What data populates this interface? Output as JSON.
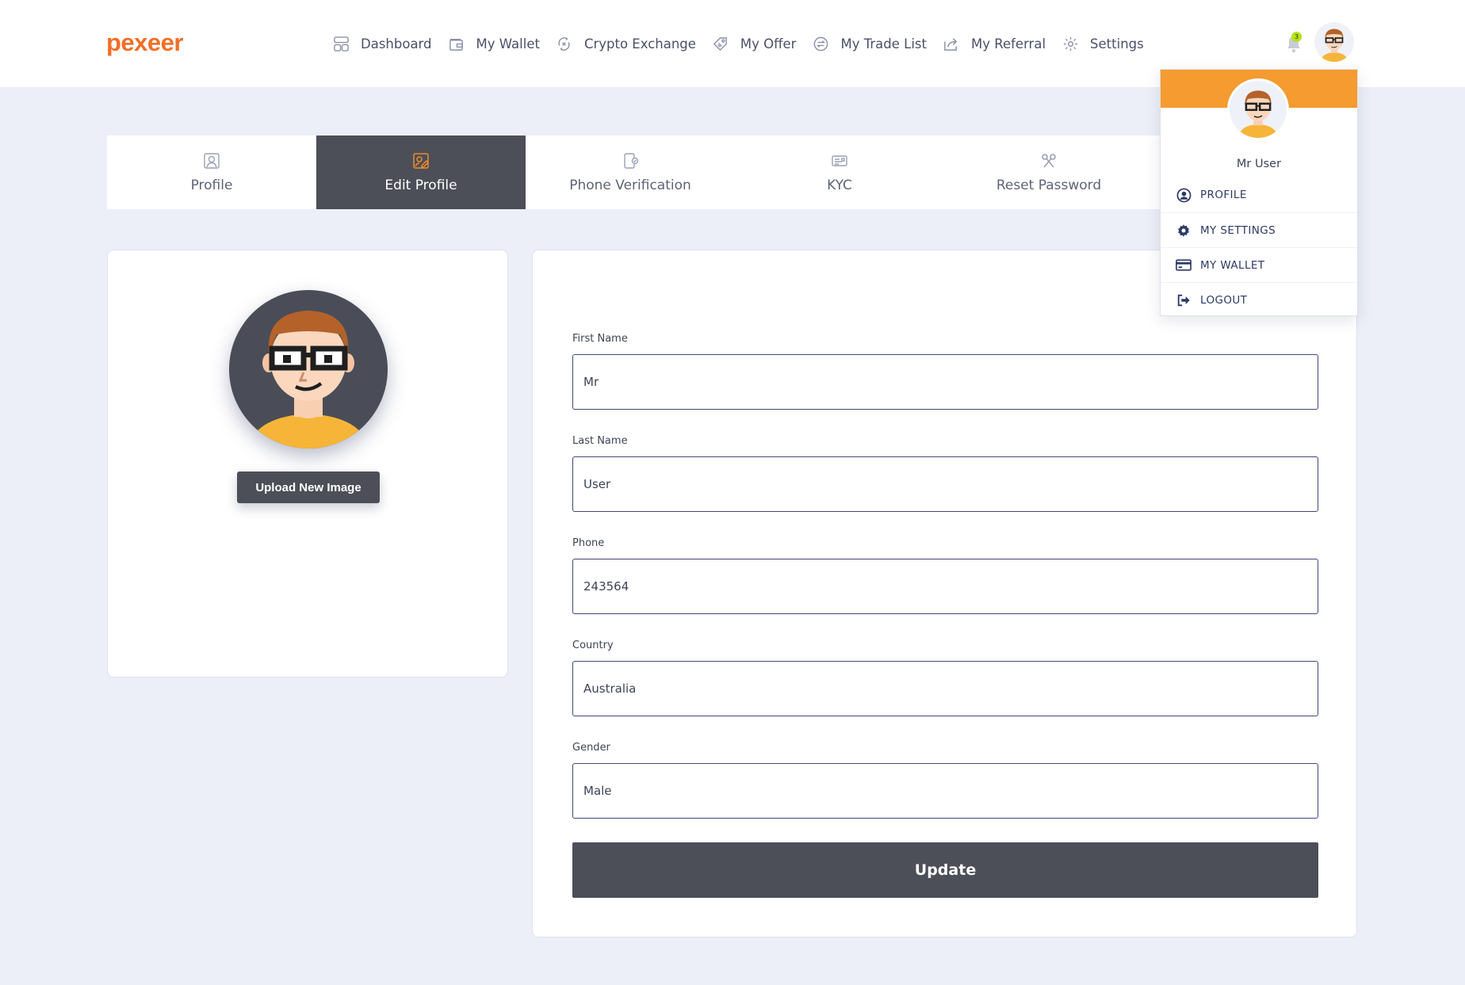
{
  "brand": {
    "name": "pexeer",
    "accent": "#f26e26"
  },
  "nav": [
    {
      "label": "Dashboard",
      "icon": "dashboard-icon"
    },
    {
      "label": "My Wallet",
      "icon": "wallet-icon"
    },
    {
      "label": "Crypto Exchange",
      "icon": "exchange-icon"
    },
    {
      "label": "My Offer",
      "icon": "tag-icon"
    },
    {
      "label": "My Trade List",
      "icon": "trade-icon"
    },
    {
      "label": "My Referral",
      "icon": "share-icon"
    },
    {
      "label": "Settings",
      "icon": "gear-icon"
    }
  ],
  "notifications": {
    "count": "3"
  },
  "tabs": [
    {
      "label": "Profile",
      "icon": "user-icon"
    },
    {
      "label": "Edit Profile",
      "icon": "edit-icon",
      "active": true
    },
    {
      "label": "Phone Verification",
      "icon": "phone-icon"
    },
    {
      "label": "KYC",
      "icon": "id-card-icon"
    },
    {
      "label": "Reset Password",
      "icon": "key-icon"
    }
  ],
  "avatar_card": {
    "upload_label": "Upload New Image"
  },
  "form": {
    "first_name": {
      "label": "First Name",
      "value": "Mr"
    },
    "last_name": {
      "label": "Last Name",
      "value": "User"
    },
    "phone": {
      "label": "Phone",
      "value": "243564"
    },
    "country": {
      "label": "Country",
      "value": "Australia"
    },
    "gender": {
      "label": "Gender",
      "value": "Male"
    },
    "submit_label": "Update"
  },
  "user_menu": {
    "name": "Mr User",
    "items": [
      {
        "label": "PROFILE",
        "icon": "user-circle-icon"
      },
      {
        "label": "MY SETTINGS",
        "icon": "cog-icon"
      },
      {
        "label": "MY WALLET",
        "icon": "credit-card-icon"
      },
      {
        "label": "LOGOUT",
        "icon": "logout-icon"
      }
    ]
  },
  "colors": {
    "banner": "#f59b2f",
    "dark_button": "#4c4f58",
    "background": "#eceff7",
    "badge": "#b6e21c"
  }
}
